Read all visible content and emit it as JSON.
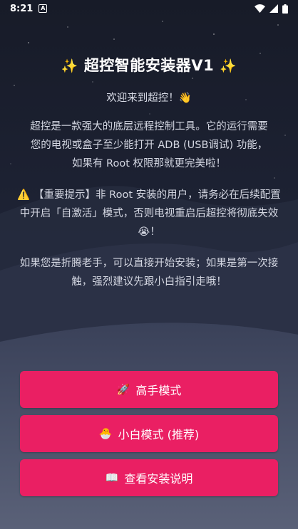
{
  "status_bar": {
    "time": "8:21",
    "notification_icon": "a-icon"
  },
  "header": {
    "sparkle_left": "✨",
    "title": "超控智能安装器V1",
    "sparkle_right": "✨"
  },
  "welcome": "欢迎来到超控！👋",
  "intro_lines": [
    "超控是一款强大的底层远程控制工具。它的运行需要",
    "您的电视或盒子至少能打开 ADB (USB调试) 功能，",
    "如果有 Root 权限那就更完美啦！"
  ],
  "warning": {
    "icon": "⚠️",
    "text": "【重要提示】非 Root 安装的用户，请务必在后续配置中开启「自激活」模式，否则电视重启后超控将彻底失效😭！"
  },
  "advice": "如果您是折腾老手，可以直接开始安装；如果是第一次接触，强烈建议先跟小白指引走哦！",
  "buttons": {
    "expert": {
      "icon": "🚀",
      "label": "高手模式"
    },
    "beginner": {
      "icon": "🐣",
      "label": "小白模式 (推荐)"
    },
    "guide": {
      "icon": "📖",
      "label": "查看安装说明"
    }
  },
  "colors": {
    "accent": "#ea1f63",
    "warning": "#f5c400",
    "background": "#1b2030"
  }
}
